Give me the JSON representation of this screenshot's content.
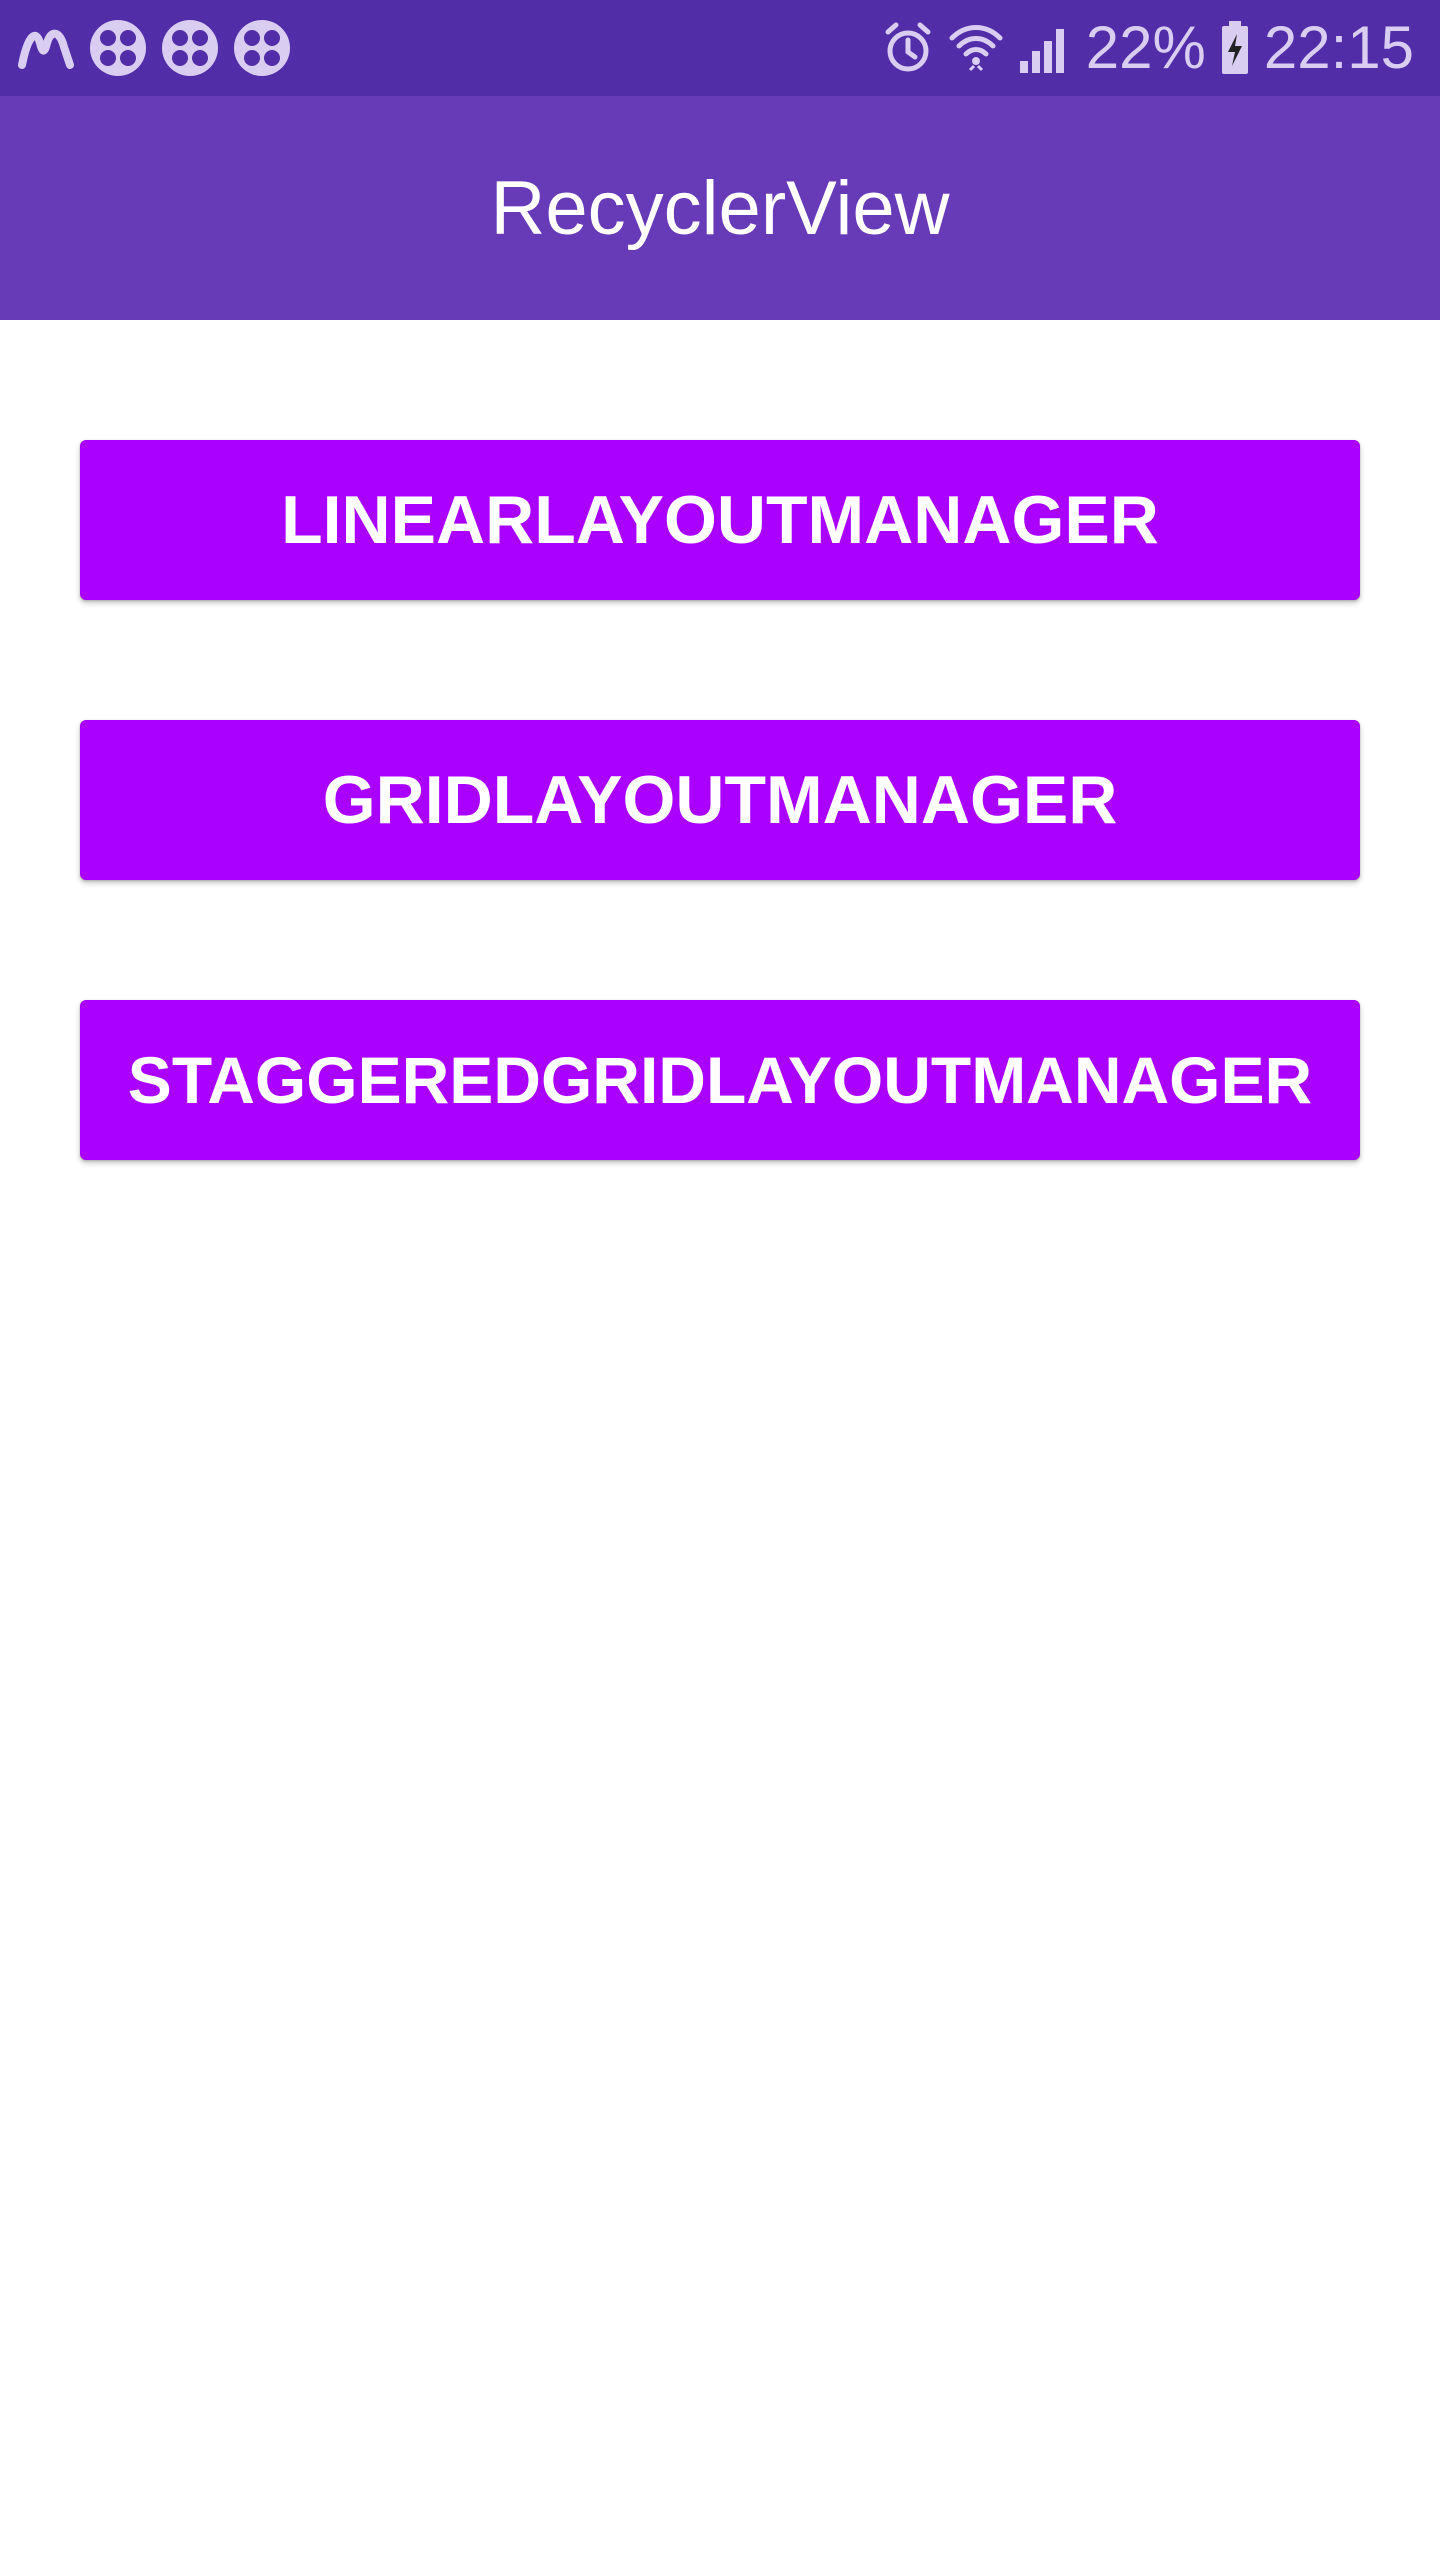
{
  "status_bar": {
    "left_icons": [
      "m-app-icon",
      "clover-app-icon",
      "clover-app-icon",
      "clover-app-icon"
    ],
    "right_icons": [
      "alarm-icon",
      "wifi-icon",
      "signal-icon",
      "battery-charging-icon"
    ],
    "battery_percent": "22%",
    "time": "22:15",
    "background_color": "#512da8"
  },
  "app_bar": {
    "title": "RecyclerView",
    "background_color": "#673ab7"
  },
  "buttons": [
    {
      "label": "LINEARLAYOUTMANAGER"
    },
    {
      "label": "GRIDLAYOUTMANAGER"
    },
    {
      "label": "STAGGEREDGRIDLAYOUTMANAGER"
    }
  ],
  "colors": {
    "button": "#aa00ff",
    "button_text": "#ffffff",
    "background": "#ffffff"
  }
}
